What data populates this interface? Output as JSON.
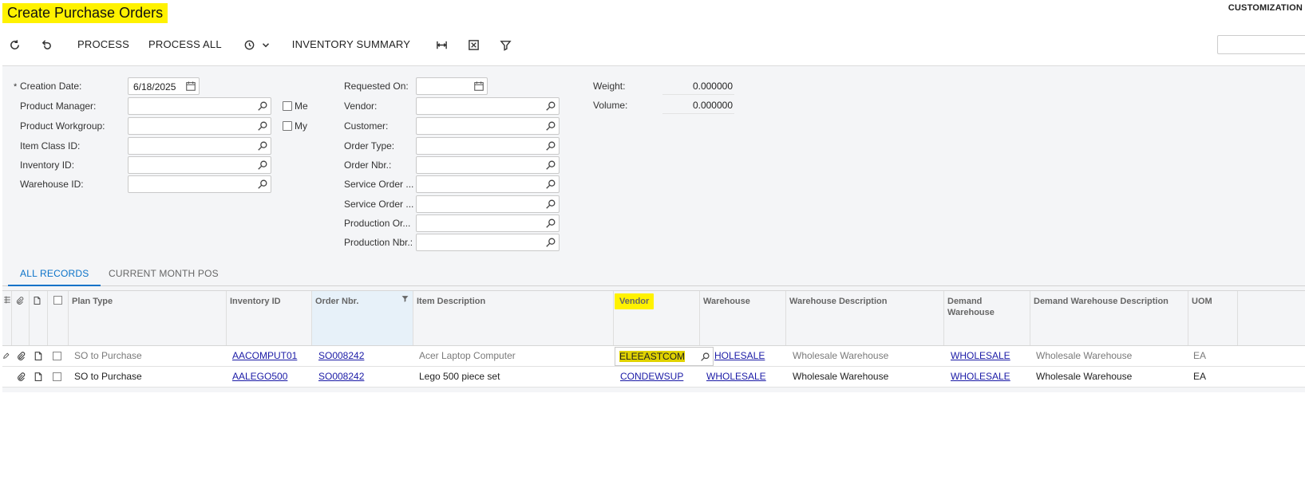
{
  "header": {
    "title": "Create Purchase Orders",
    "customization": "CUSTOMIZATION"
  },
  "toolbar": {
    "refresh_icon": "refresh-icon",
    "undo_icon": "undo-icon",
    "process": "PROCESS",
    "process_all": "PROCESS ALL",
    "schedule_icon": "schedule-icon",
    "inventory_summary": "INVENTORY SUMMARY",
    "fit_icon": "fit-columns-icon",
    "excel_icon": "excel-export-icon",
    "filter_icon": "filter-icon"
  },
  "filters": {
    "left": [
      {
        "label": "Creation Date:",
        "value": "6/18/2025",
        "required": true
      },
      {
        "label": "Product Manager:",
        "value": ""
      },
      {
        "label": "Product Workgroup:",
        "value": ""
      },
      {
        "label": "Item Class ID:",
        "value": ""
      },
      {
        "label": "Inventory ID:",
        "value": ""
      },
      {
        "label": "Warehouse ID:",
        "value": ""
      }
    ],
    "me_label": "Me",
    "my_label": "My",
    "middle": [
      {
        "label": "Requested On:",
        "value": ""
      },
      {
        "label": "Vendor:",
        "value": ""
      },
      {
        "label": "Customer:",
        "value": ""
      },
      {
        "label": "Order Type:",
        "value": ""
      },
      {
        "label": "Order Nbr.:",
        "value": ""
      },
      {
        "label": "Service Order ...",
        "value": ""
      },
      {
        "label": "Service Order ...",
        "value": ""
      },
      {
        "label": "Production Or...",
        "value": ""
      },
      {
        "label": "Production Nbr.:",
        "value": ""
      }
    ],
    "weight_label": "Weight:",
    "weight_value": "0.000000",
    "volume_label": "Volume:",
    "volume_value": "0.000000"
  },
  "tabs": [
    {
      "label": "ALL RECORDS",
      "active": true
    },
    {
      "label": "CURRENT MONTH POS",
      "active": false
    }
  ],
  "grid": {
    "columns": {
      "plan_type": "Plan Type",
      "inventory_id": "Inventory ID",
      "order_nbr": "Order Nbr.",
      "item_description": "Item Description",
      "vendor": "Vendor",
      "warehouse": "Warehouse",
      "warehouse_description": "Warehouse Description",
      "demand_warehouse": "Demand Warehouse",
      "demand_warehouse_description": "Demand Warehouse Description",
      "uom": "UOM"
    },
    "rows": [
      {
        "plan_type": "SO to Purchase",
        "inventory_id": "AACOMPUT01",
        "order_nbr": "SO008242",
        "item_description": "Acer Laptop Computer",
        "vendor": "ELEEASTCOM",
        "warehouse": "HOLESALE",
        "warehouse_description": "Wholesale Warehouse",
        "demand_warehouse": "WHOLESALE",
        "demand_warehouse_description": "Wholesale Warehouse",
        "uom": "EA"
      },
      {
        "plan_type": "SO to Purchase",
        "inventory_id": "AALEGO500",
        "order_nbr": "SO008242",
        "item_description": "Lego 500 piece set",
        "vendor": "CONDEWSUP",
        "warehouse": "WHOLESALE",
        "warehouse_description": "Wholesale Warehouse",
        "demand_warehouse": "WHOLESALE",
        "demand_warehouse_description": "Wholesale Warehouse",
        "uom": "EA"
      }
    ]
  },
  "colors": {
    "highlight": "#fff200",
    "accent": "#0a72c8",
    "link": "#1a1aa6"
  }
}
